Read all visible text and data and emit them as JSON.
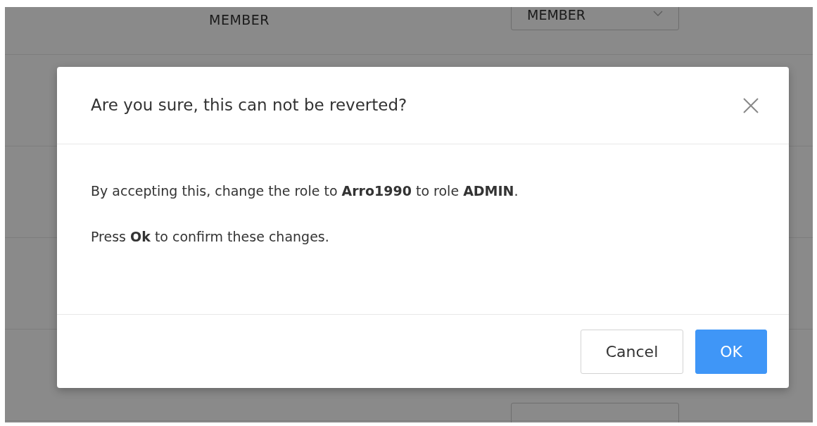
{
  "background_row": {
    "role_text": "MEMBER",
    "role_select": "MEMBER"
  },
  "dialog": {
    "title": "Are you sure, this can not be reverted?",
    "paragraphs": [
      "By accepting this, change the role to **Arro1990** to role **ADMIN**.",
      "Press **Ok** to confirm these changes."
    ],
    "buttons": [
      {
        "label": "Cancel",
        "kind": "secondary"
      },
      {
        "label": "OK",
        "kind": "primary"
      }
    ]
  }
}
